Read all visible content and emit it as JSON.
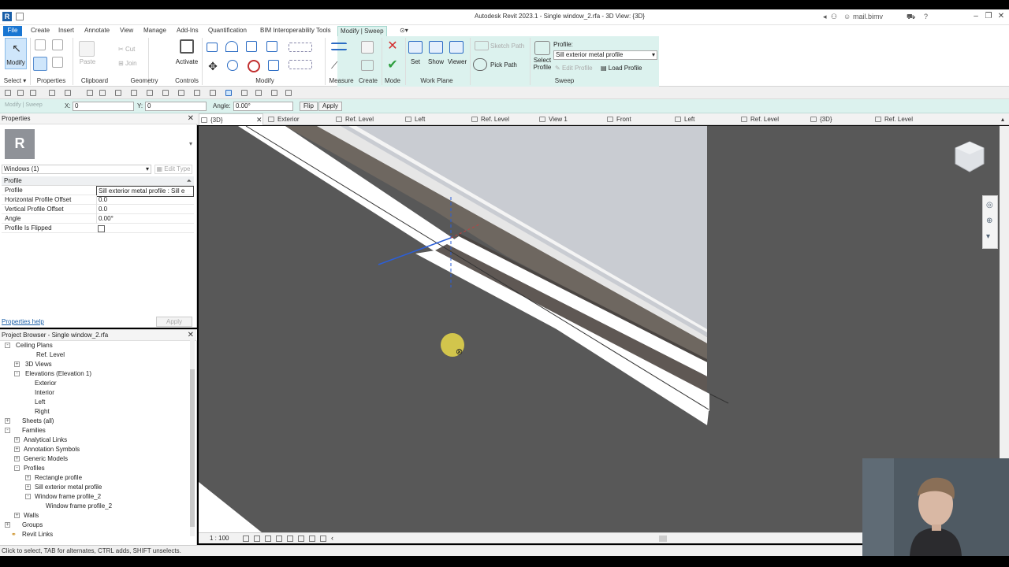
{
  "app": {
    "title": "Autodesk Revit 2023.1 - Single window_2.rfa - 3D View: {3D}",
    "user": "mail.bimv"
  },
  "tabs": [
    "File",
    "Create",
    "Insert",
    "Annotate",
    "View",
    "Manage",
    "Add-Ins",
    "Quantification",
    "BIM Interoperability Tools",
    "Modify | Sweep"
  ],
  "ribbon": {
    "modify": "Modify",
    "paste": "Paste",
    "cut": "Cut",
    "join": "Join",
    "activate": "Activate",
    "set": "Set",
    "show": "Show",
    "viewer": "Viewer",
    "sketch_path": "Sketch Path",
    "pick_path": "Pick Path",
    "profile_label": "Profile:",
    "profile_value": "Sill exterior metal profile",
    "select_profile_line1": "Select",
    "select_profile_line2": "Profile",
    "edit_profile": "Edit Profile",
    "load_profile": "Load Profile",
    "panels": {
      "select": "Select",
      "properties": "Properties",
      "clipboard": "Clipboard",
      "geometry": "Geometry",
      "controls": "Controls",
      "modify": "Modify",
      "measure": "Measure",
      "create": "Create",
      "mode": "Mode",
      "work_plane": "Work Plane",
      "sweep": "Sweep"
    }
  },
  "options_bar": {
    "context": "Modify | Sweep",
    "x_label": "X:",
    "x_value": "0",
    "y_label": "Y:",
    "y_value": "0",
    "angle_label": "Angle:",
    "angle_value": "0.00°",
    "flip": "Flip",
    "apply": "Apply"
  },
  "properties": {
    "title": "Properties",
    "type_selector": "Windows (1)",
    "edit_type": "Edit Type",
    "category": "Profile",
    "rows": [
      {
        "key": "Profile",
        "value": "Sill exterior metal profile : Sill e"
      },
      {
        "key": "Horizontal Profile Offset",
        "value": "0.0"
      },
      {
        "key": "Vertical Profile Offset",
        "value": "0.0"
      },
      {
        "key": "Angle",
        "value": "0.00°"
      },
      {
        "key": "Profile Is Flipped",
        "value": ""
      }
    ],
    "help": "Properties help",
    "apply": "Apply"
  },
  "browser": {
    "title": "Project Browser - Single window_2.rfa",
    "items": [
      "Ceiling Plans",
      "Ref. Level",
      "3D Views",
      "Elevations (Elevation 1)",
      "Exterior",
      "Interior",
      "Left",
      "Right",
      "Sheets (all)",
      "Families",
      "Analytical Links",
      "Annotation Symbols",
      "Generic Models",
      "Profiles",
      "Rectangle profile",
      "Sill exterior metal profile",
      "Window frame profile_2",
      "Window frame profile_2",
      "Walls",
      "Groups",
      "Revit Links"
    ]
  },
  "view_tabs": [
    "{3D}",
    "Exterior",
    "Ref. Level",
    "Left",
    "Ref. Level",
    "View 1",
    "Front",
    "Left",
    "Ref. Level",
    "{3D}",
    "Ref. Level"
  ],
  "view_control": {
    "scale": "1 : 100"
  },
  "status": "Click to select, TAB for alternates, CTRL adds, SHIFT unselects.",
  "colors": {
    "ribbon_context": "#dcf2ee",
    "file_tab": "#1976d2",
    "viewport_bg": "#585858",
    "sill_dark": "#6e6760",
    "sill_light": "#ffffff",
    "glass": "#c9ccd2"
  }
}
